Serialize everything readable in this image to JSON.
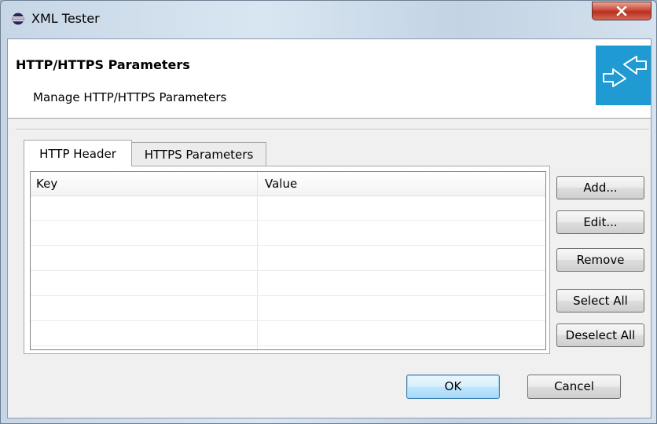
{
  "window": {
    "title": "XML Tester",
    "app_icon": "eclipse-icon",
    "close_icon": "close-icon",
    "close_color": "#c9493a"
  },
  "banner": {
    "title": "HTTP/HTTPS Parameters",
    "description": "Manage HTTP/HTTPS Parameters",
    "icon": "exchange-arrows-icon",
    "icon_background": "#1f9ad2"
  },
  "tabs": [
    {
      "label": "HTTP Header",
      "selected": true
    },
    {
      "label": "HTTPS Parameters",
      "selected": false
    }
  ],
  "table": {
    "columns": [
      "Key",
      "Value"
    ],
    "rows": []
  },
  "side_buttons": {
    "add": "Add...",
    "edit": "Edit...",
    "remove": "Remove",
    "select_all": "Select All",
    "deselect_all": "Deselect All"
  },
  "footer": {
    "ok": "OK",
    "cancel": "Cancel"
  }
}
